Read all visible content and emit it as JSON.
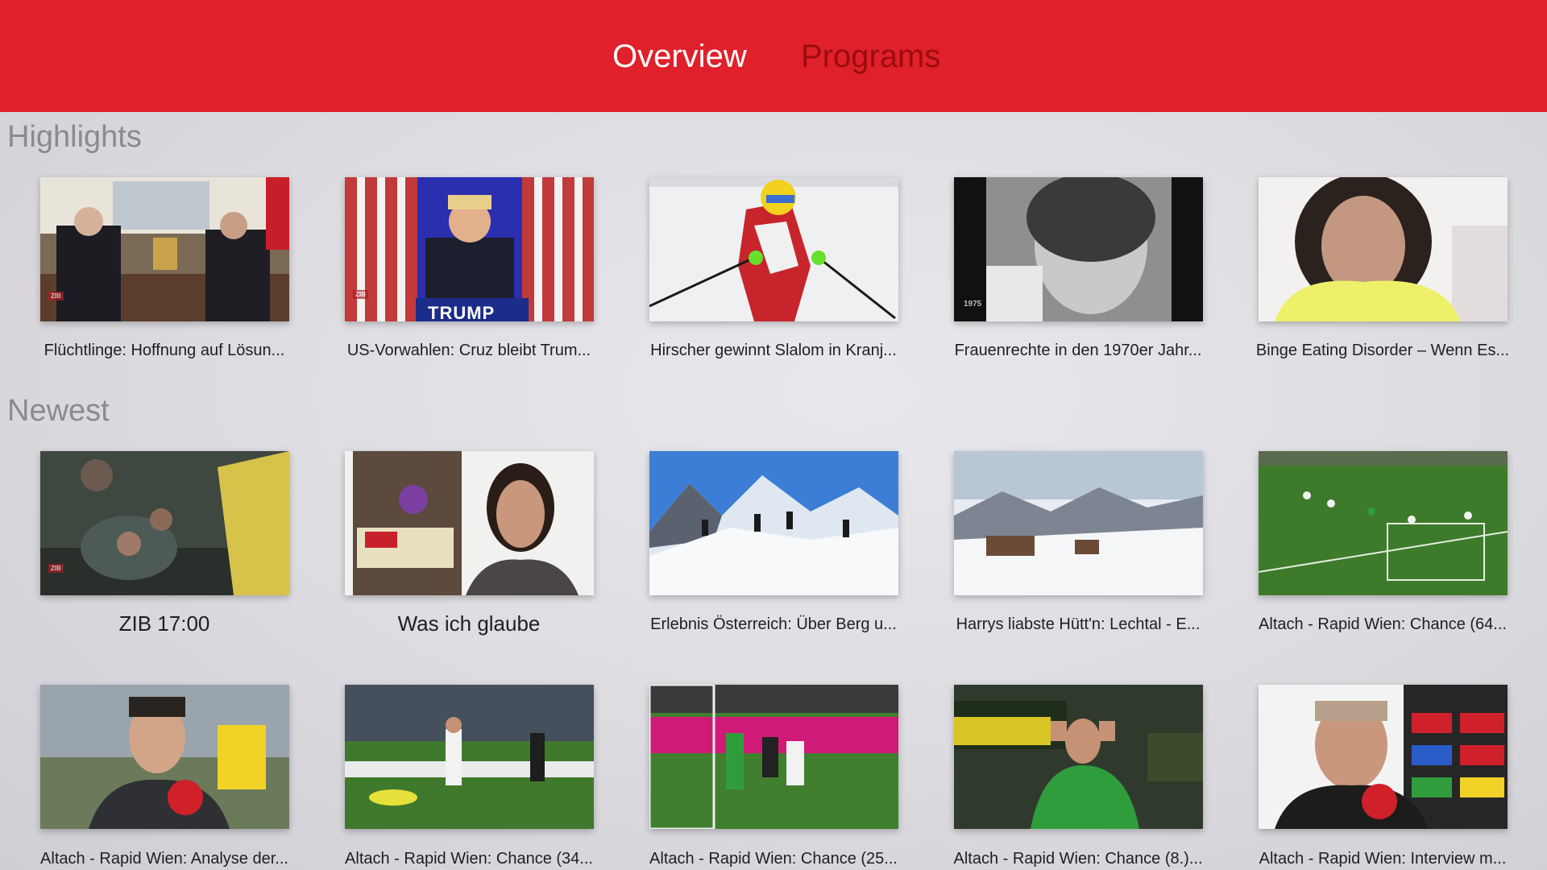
{
  "nav": {
    "tabs": [
      {
        "label": "Overview",
        "active": true
      },
      {
        "label": "Programs",
        "active": false
      }
    ],
    "bar_color": "#e0202a"
  },
  "sections": {
    "highlights": {
      "title": "Highlights",
      "items": [
        {
          "caption": "Flüchtlinge: Hoffnung auf Lösun...",
          "thumb_overlay": "ZIB"
        },
        {
          "caption": "US-Vorwahlen: Cruz bleibt Trum...",
          "thumb_overlay": "ZIB",
          "thumb_sign": "TRUMP"
        },
        {
          "caption": "Hirscher gewinnt Slalom in Kranj..."
        },
        {
          "caption": "Frauenrechte in den 1970er Jahr...",
          "thumb_overlay": "1975"
        },
        {
          "caption": "Binge Eating Disorder – Wenn Es..."
        }
      ]
    },
    "newest": {
      "title": "Newest",
      "items": [
        {
          "caption": "ZIB 17:00",
          "thumb_overlay": "ZIB"
        },
        {
          "caption": "Was ich glaube"
        },
        {
          "caption": "Erlebnis Österreich: Über Berg u..."
        },
        {
          "caption": "Harrys liabste Hütt'n: Lechtal - E..."
        },
        {
          "caption": "Altach - Rapid Wien: Chance (64..."
        },
        {
          "caption": "Altach - Rapid Wien: Analyse der..."
        },
        {
          "caption": "Altach - Rapid Wien: Chance (34..."
        },
        {
          "caption": "Altach - Rapid Wien: Chance (25..."
        },
        {
          "caption": "Altach - Rapid Wien: Chance (8.)..."
        },
        {
          "caption": "Altach - Rapid Wien: Interview m..."
        }
      ]
    }
  }
}
